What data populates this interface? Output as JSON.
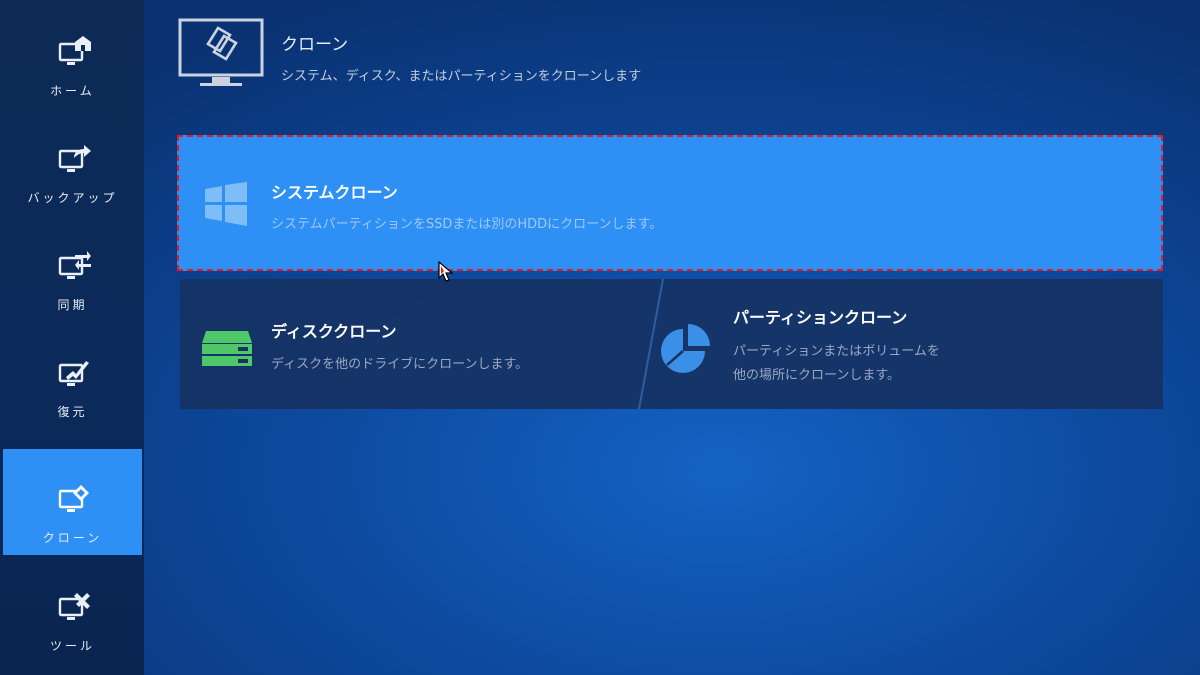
{
  "sidebar": {
    "items": [
      {
        "label": "ホーム",
        "icon": "home-monitor-icon",
        "active": false
      },
      {
        "label": "バックアップ",
        "icon": "backup-monitor-icon",
        "active": false
      },
      {
        "label": "同期",
        "icon": "sync-monitor-icon",
        "active": false
      },
      {
        "label": "復元",
        "icon": "restore-monitor-icon",
        "active": false
      },
      {
        "label": "クローン",
        "icon": "clone-monitor-icon",
        "active": true
      },
      {
        "label": "ツール",
        "icon": "tools-monitor-icon",
        "active": false
      }
    ]
  },
  "header": {
    "icon": "clone-monitor-icon",
    "title": "クローン",
    "subtitle": "システム、ディスク、またはパーティションをクローンします"
  },
  "options": {
    "system": {
      "title": "システムクローン",
      "description": "システムパーティションをSSDまたは別のHDDにクローンします。",
      "icon": "windows-logo-icon",
      "highlighted": true
    },
    "disk": {
      "title": "ディスククローン",
      "description": "ディスクを他のドライブにクローンします。",
      "icon": "disk-drive-icon"
    },
    "partition": {
      "title": "パーティションクローン",
      "description_line1": "パーティションまたはボリュームを",
      "description_line2": "他の場所にクローンします。",
      "icon": "pie-chart-icon"
    }
  },
  "colors": {
    "accent": "#2e8ff4",
    "sidebar": "#0d2a55",
    "highlight_border": "#e31b23",
    "disk_icon": "#4fc86a",
    "partition_icon": "#3c8fe6"
  }
}
